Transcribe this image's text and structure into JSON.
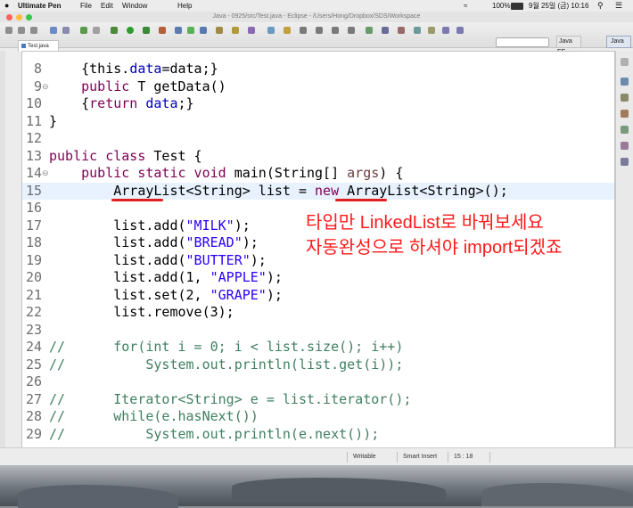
{
  "menubar": {
    "app_name": "Ultimate Pen",
    "items": [
      "File",
      "Edit",
      "Window",
      "Help"
    ],
    "battery": "100%",
    "clock": "9월 25일 (금)  10:16"
  },
  "window": {
    "title": "Java - 0925/src/Test.java - Eclipse - /Users/Hong/Dropbox/SDS/Workspace",
    "perspectives": [
      "Java EE",
      "Java"
    ]
  },
  "editor": {
    "tab_label": "Test.java",
    "current_line": 15,
    "lines": [
      {
        "num": "8",
        "html": "    <span class=\"cls\">{this.</span><span class=\"fld\">data</span>=data;}"
      },
      {
        "num": "9",
        "fold": "⊖",
        "html": "    <span class=\"kw\">public</span> T getData()"
      },
      {
        "num": "10",
        "html": "    {<span class=\"kw\">return</span> <span class=\"fld\">data</span>;}"
      },
      {
        "num": "11",
        "html": "}"
      },
      {
        "num": "12",
        "html": ""
      },
      {
        "num": "13",
        "html": "<span class=\"kw\">public class</span> Test {"
      },
      {
        "num": "14",
        "fold": "⊖",
        "html": "    <span class=\"kw\">public static void</span> main(String[] <span class=\"fld\" style=\"color:#6a3e3e\">args</span>) {"
      },
      {
        "num": "15",
        "html": "        ArrayList&lt;String&gt; list = <span class=\"kw\">new</span> ArrayList&lt;String&gt;();"
      },
      {
        "num": "16",
        "html": ""
      },
      {
        "num": "17",
        "html": "        list.add(<span class=\"str\">\"MILK\"</span>);"
      },
      {
        "num": "18",
        "html": "        list.add(<span class=\"str\">\"BREAD\"</span>);"
      },
      {
        "num": "19",
        "html": "        list.add(<span class=\"str\">\"BUTTER\"</span>);"
      },
      {
        "num": "20",
        "html": "        list.add(1, <span class=\"str\">\"APPLE\"</span>);"
      },
      {
        "num": "21",
        "html": "        list.set(2, <span class=\"str\">\"GRAPE\"</span>);"
      },
      {
        "num": "22",
        "html": "        list.remove(3);"
      },
      {
        "num": "23",
        "html": ""
      },
      {
        "num": "24",
        "html": "<span class=\"cm\">//      for(int i = 0; i &lt; list.size(); i++)</span>"
      },
      {
        "num": "25",
        "html": "<span class=\"cm\">//          System.out.println(list.get(i));</span>"
      },
      {
        "num": "26",
        "html": ""
      },
      {
        "num": "27",
        "html": "<span class=\"cm\">//      Iterator&lt;String&gt; e = list.iterator();</span>"
      },
      {
        "num": "28",
        "html": "<span class=\"cm\">//      while(e.hasNext())</span>"
      },
      {
        "num": "29",
        "html": "<span class=\"cm\">//          System.out.println(e.next());</span>"
      }
    ]
  },
  "annotation": {
    "line1": "타입만 LinkedList로 바꿔보세요",
    "line2": "자동완성으로 하셔야 import되겠죠",
    "color": "#ff1a1a"
  },
  "statusbar": {
    "writable": "Writable",
    "insert_mode": "Smart Insert",
    "position": "15 : 18"
  }
}
